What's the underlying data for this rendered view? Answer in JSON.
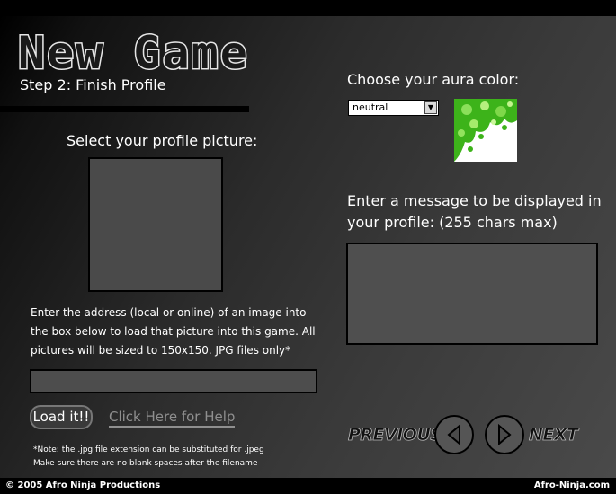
{
  "title": "New Game",
  "subtitle": "Step 2: Finish Profile",
  "profile": {
    "heading": "Select your profile picture:",
    "instructions": "Enter the address (local or online) of an image into the box below to load that picture into this game. All pictures will be sized to 150x150. JPG files only*",
    "url_value": "",
    "load_label": "Load it!!",
    "help_label": "Click Here for Help",
    "note_line1": "*Note: the .jpg  file extension can be substituted for .jpeg",
    "note_line2": "Make sure there are no blank spaces after the filename"
  },
  "aura": {
    "heading": "Choose your aura color:",
    "selected": "neutral",
    "swatch_color": "#3db31a"
  },
  "message": {
    "heading_line1": "Enter a message to be displayed in",
    "heading_line2": "your profile: (255 chars max)",
    "value": ""
  },
  "nav": {
    "previous": "PREVIOUS",
    "next": "NEXT"
  },
  "footer": {
    "copyright": "© 2005 Afro Ninja Productions",
    "site": "Afro-Ninja.com"
  }
}
